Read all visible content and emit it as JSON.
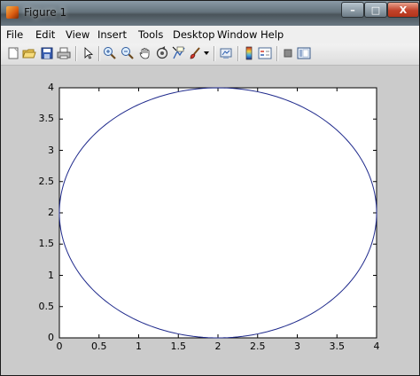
{
  "window": {
    "title": "Figure 1"
  },
  "window_buttons": {
    "minimize": "–",
    "maximize": "□",
    "close": "X"
  },
  "menu": [
    "File",
    "Edit",
    "View",
    "Insert",
    "Tools",
    "Desktop",
    "Window",
    "Help"
  ],
  "toolbar": {
    "icons": [
      "new-figure-icon",
      "open-file-icon",
      "save-icon",
      "print-icon",
      "pointer-icon",
      "zoom-in-icon",
      "zoom-out-icon",
      "pan-hand-icon",
      "rotate-3d-icon",
      "data-cursor-icon",
      "brush-icon",
      "brush-dropdown-icon",
      "link-plot-icon",
      "colorbar-icon",
      "legend-icon",
      "hide-plot-tools-icon",
      "show-plot-tools-icon"
    ]
  },
  "plot": {
    "xticks": [
      "0",
      "0.5",
      "1",
      "1.5",
      "2",
      "2.5",
      "3",
      "3.5",
      "4"
    ],
    "yticks": [
      "0",
      "0.5",
      "1",
      "1.5",
      "2",
      "2.5",
      "3",
      "3.5",
      "4"
    ],
    "line_color": "#1f2a8c"
  },
  "chart_data": {
    "type": "line",
    "title": "",
    "xlabel": "",
    "ylabel": "",
    "xlim": [
      0,
      4
    ],
    "ylim": [
      0,
      4
    ],
    "grid": false,
    "series": [
      {
        "description_shape": "circle",
        "center": [
          2,
          2
        ],
        "radius": 2,
        "points": [
          [
            0,
            2
          ],
          [
            0.268,
            1
          ],
          [
            1,
            0.268
          ],
          [
            2,
            0
          ],
          [
            3,
            0.268
          ],
          [
            3.732,
            1
          ],
          [
            4,
            2
          ],
          [
            3.732,
            3
          ],
          [
            3,
            3.732
          ],
          [
            2,
            4
          ],
          [
            1,
            3.732
          ],
          [
            0.268,
            3
          ],
          [
            0,
            2
          ]
        ]
      }
    ]
  }
}
